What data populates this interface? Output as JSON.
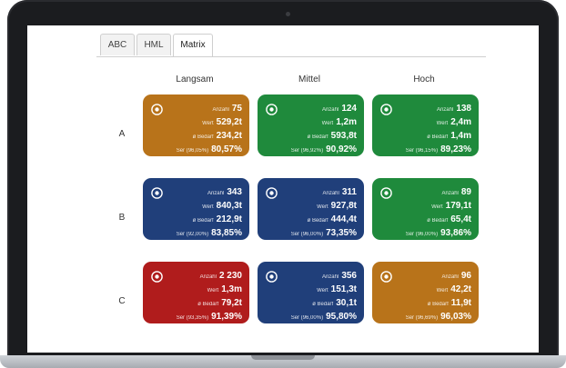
{
  "tabs": [
    {
      "label": "ABC",
      "active": false
    },
    {
      "label": "HML",
      "active": false
    },
    {
      "label": "Matrix",
      "active": true
    }
  ],
  "columns": [
    "Langsam",
    "Mittel",
    "Hoch"
  ],
  "rows": [
    "A",
    "B",
    "C"
  ],
  "labels": {
    "anzahl": "Anzahl",
    "wert": "Wert",
    "bedarf": "ø Bedarf"
  },
  "cells": [
    {
      "color": "#b8731a",
      "anzahl": "75",
      "wert": "529,2t",
      "bedarf": "234,2t",
      "ser_label": "Ser (96,05%)",
      "ser": "80,57%"
    },
    {
      "color": "#1f8a3c",
      "anzahl": "124",
      "wert": "1,2m",
      "bedarf": "593,8t",
      "ser_label": "Ser (96,92%)",
      "ser": "90,92%"
    },
    {
      "color": "#1f8a3c",
      "anzahl": "138",
      "wert": "2,4m",
      "bedarf": "1,4m",
      "ser_label": "Ser (96,15%)",
      "ser": "89,23%"
    },
    {
      "color": "#203f7a",
      "anzahl": "343",
      "wert": "840,3t",
      "bedarf": "212,9t",
      "ser_label": "Ser (92,00%)",
      "ser": "83,85%"
    },
    {
      "color": "#203f7a",
      "anzahl": "311",
      "wert": "927,8t",
      "bedarf": "444,4t",
      "ser_label": "Ser (96,00%)",
      "ser": "73,35%"
    },
    {
      "color": "#1f8a3c",
      "anzahl": "89",
      "wert": "179,1t",
      "bedarf": "65,4t",
      "ser_label": "Ser (96,00%)",
      "ser": "93,86%"
    },
    {
      "color": "#b01c1c",
      "anzahl": "2 230",
      "wert": "1,3m",
      "bedarf": "79,2t",
      "ser_label": "Ser (93,35%)",
      "ser": "91,39%"
    },
    {
      "color": "#203f7a",
      "anzahl": "356",
      "wert": "151,3t",
      "bedarf": "30,1t",
      "ser_label": "Ser (96,00%)",
      "ser": "95,80%"
    },
    {
      "color": "#b8731a",
      "anzahl": "96",
      "wert": "42,2t",
      "bedarf": "11,9t",
      "ser_label": "Ser (96,69%)",
      "ser": "96,03%"
    }
  ]
}
